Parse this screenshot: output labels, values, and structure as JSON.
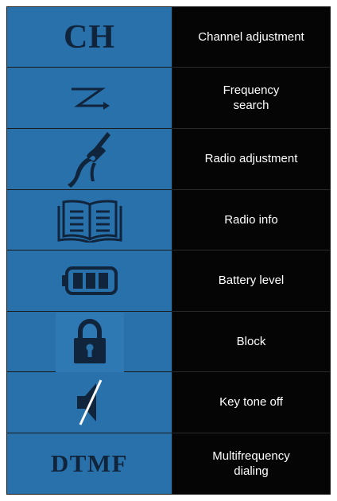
{
  "rows": [
    {
      "icon": "ch-text-icon",
      "glyph": "CH",
      "label": "Channel adjustment"
    },
    {
      "icon": "frequency-search-arrow-icon",
      "label": "Frequency\nsearch"
    },
    {
      "icon": "pliers-icon",
      "label": "Radio adjustment"
    },
    {
      "icon": "open-book-icon",
      "label": "Radio info"
    },
    {
      "icon": "battery-icon",
      "label": "Battery level"
    },
    {
      "icon": "padlock-icon",
      "label": "Block"
    },
    {
      "icon": "speaker-muted-icon",
      "label": "Key tone off"
    },
    {
      "icon": "dtmf-text-icon",
      "glyph": "DTMF",
      "label": "Multifrequency\ndialing"
    }
  ],
  "colors": {
    "icon_cell_bg": "#2971ab",
    "icon_fg": "#10243c",
    "label_cell_bg": "#050505",
    "label_fg": "#ffffff"
  }
}
